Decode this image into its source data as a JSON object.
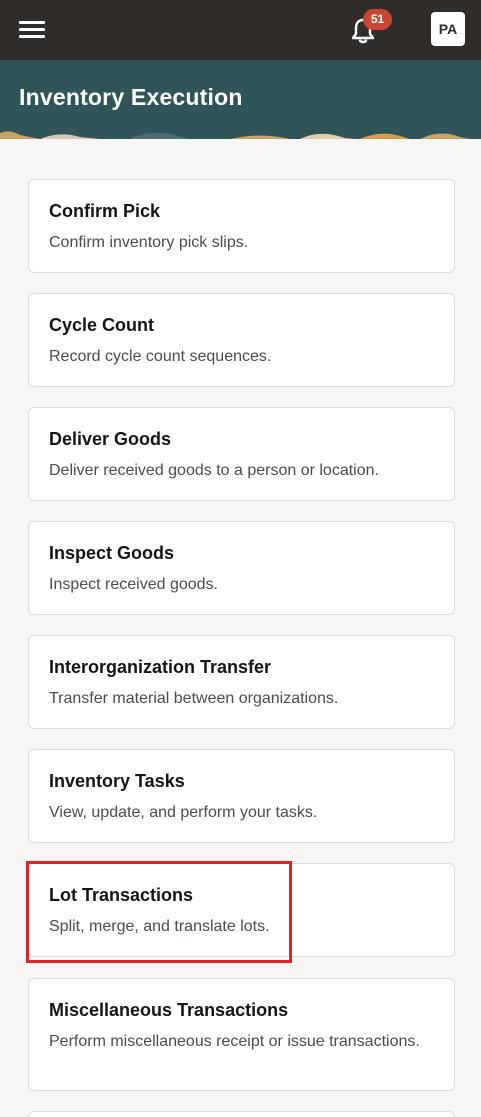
{
  "topbar": {
    "menu_icon": "hamburger-menu-icon",
    "bell_icon": "bell-icon",
    "notification_count": "51",
    "avatar_initials": "PA",
    "bg_color": "#312d2a",
    "badge_color": "#c74634"
  },
  "header": {
    "title": "Inventory Execution",
    "bg_color": "#2f5559"
  },
  "cards": [
    {
      "title": "Confirm Pick",
      "desc": "Confirm inventory pick slips."
    },
    {
      "title": "Cycle Count",
      "desc": "Record cycle count sequences."
    },
    {
      "title": "Deliver Goods",
      "desc": "Deliver received goods to a person or location."
    },
    {
      "title": "Inspect Goods",
      "desc": "Inspect received goods."
    },
    {
      "title": "Interorganization Transfer",
      "desc": "Transfer material between organizations."
    },
    {
      "title": "Inventory Tasks",
      "desc": "View, update, and perform your tasks."
    },
    {
      "title": "Lot Transactions",
      "desc": "Split, merge, and translate lots."
    },
    {
      "title": "Miscellaneous Transactions",
      "desc": "Perform miscellaneous receipt or issue transactions."
    }
  ],
  "highlight_color": "#e32222"
}
